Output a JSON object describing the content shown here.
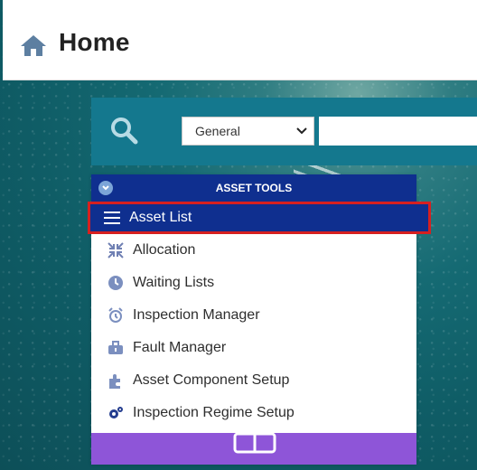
{
  "header": {
    "title": "Home",
    "icon": "home-icon"
  },
  "search": {
    "select_value": "General",
    "input_placeholder": ""
  },
  "menu": {
    "heading": "ASSET TOOLS",
    "items": [
      {
        "label": "Asset List",
        "icon": "list-icon"
      },
      {
        "label": "Allocation",
        "icon": "arrows-compress-icon"
      },
      {
        "label": "Waiting Lists",
        "icon": "clock-icon"
      },
      {
        "label": "Inspection Manager",
        "icon": "alarm-clock-icon"
      },
      {
        "label": "Fault Manager",
        "icon": "toolbox-icon"
      },
      {
        "label": "Asset Component Setup",
        "icon": "puzzle-icon"
      },
      {
        "label": "Inspection Regime Setup",
        "icon": "gears-icon"
      }
    ]
  },
  "colors": {
    "menu_header": "#0f2f8f",
    "search_bar": "#14788e",
    "footer": "#8e55d8",
    "highlight_border": "#d62020"
  }
}
